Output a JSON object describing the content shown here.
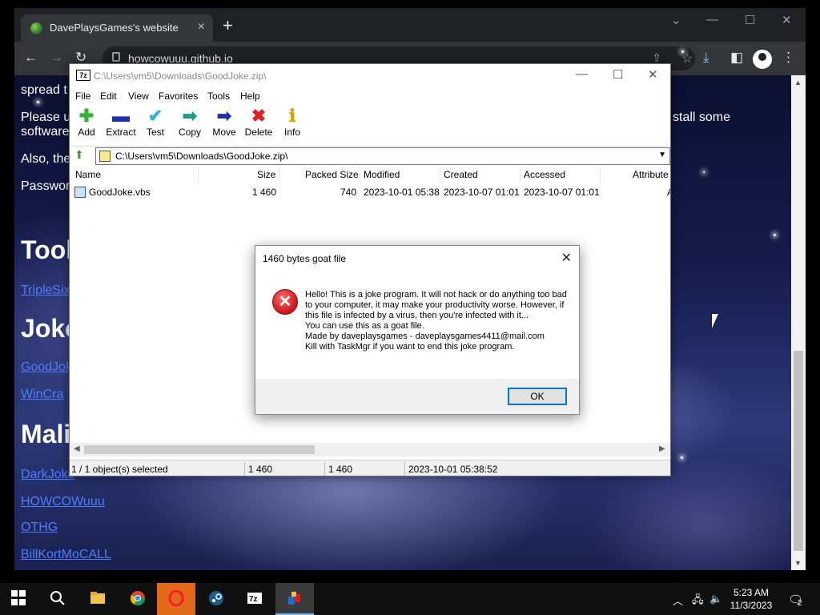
{
  "browser": {
    "tab_title": "DavePlaysGames's website",
    "tab_close": "×",
    "new_tab": "+",
    "url": "howcowuuu.github.io",
    "controls": {
      "minimize": "—",
      "maximize": "☐",
      "close": "✕",
      "more": "⌄"
    }
  },
  "page": {
    "lines": [
      "spread t",
      "Please u",
      "software",
      "Also, the",
      "Passwor"
    ],
    "right_text": "stall some",
    "headings": [
      "Tool",
      "Joke",
      "Mali"
    ],
    "links": [
      "TripleSix",
      "GoodJok",
      "WinCra",
      "DarkJoke",
      "HOWCOWuuu",
      "OTHG",
      "BillKortMoCALL"
    ]
  },
  "sevenzip": {
    "icon_label": "7z",
    "title": "C:\\Users\\vm5\\Downloads\\GoodJoke.zip\\",
    "menu": [
      "File",
      "Edit",
      "View",
      "Favorites",
      "Tools",
      "Help"
    ],
    "tools": [
      {
        "label": "Add",
        "icon": "add-icon",
        "color": "#2fb52f",
        "glyph": "✚"
      },
      {
        "label": "Extract",
        "icon": "extract-icon",
        "color": "#1c2fa8",
        "glyph": "▬"
      },
      {
        "label": "Test",
        "icon": "test-icon",
        "color": "#29b6d6",
        "glyph": "✔"
      },
      {
        "label": "Copy",
        "icon": "copy-icon",
        "color": "#1c9a8a",
        "glyph": "➡"
      },
      {
        "label": "Move",
        "icon": "move-icon",
        "color": "#1c2fa8",
        "glyph": "➡"
      },
      {
        "label": "Delete",
        "icon": "delete-icon",
        "color": "#e01f1f",
        "glyph": "✖"
      },
      {
        "label": "Info",
        "icon": "info-icon",
        "color": "#d9a400",
        "glyph": "ℹ"
      }
    ],
    "address": "C:\\Users\\vm5\\Downloads\\GoodJoke.zip\\",
    "columns": [
      "Name",
      "Size",
      "Packed Size",
      "Modified",
      "Created",
      "Accessed",
      "Attribute"
    ],
    "rows": [
      {
        "name": "GoodJoke.vbs",
        "size": "1 460",
        "packed": "740",
        "modified": "2023-10-01 05:38",
        "created": "2023-10-07 01:01",
        "accessed": "2023-10-07 01:01",
        "attr": "A"
      }
    ],
    "status": {
      "selected": "1 / 1 object(s) selected",
      "size": "1 460",
      "packed": "1 460",
      "date": "2023-10-01 05:38:52"
    }
  },
  "dialog": {
    "title": "1460 bytes goat file",
    "close": "✕",
    "message": "Hello! This is a joke program. It will not hack or do anything too bad to your computer, it may make your productivity worse. However, if this file is infected by a virus, then you're infected with it...\nYou can use this as a goat file.\nMade by daveplaysgames - daveplaysgames4411@mail.com\nKill with TaskMgr if you want to end this joke program.",
    "ok_label": "OK",
    "error_glyph": "✕"
  },
  "taskbar": {
    "time": "5:23 AM",
    "date": "11/3/2023",
    "notifications": "2",
    "apps": [
      "start-button",
      "search-icon",
      "file-explorer-icon",
      "chrome-icon",
      "opera-icon",
      "steam-icon",
      "7zip-icon",
      "joke-app-icon"
    ]
  }
}
